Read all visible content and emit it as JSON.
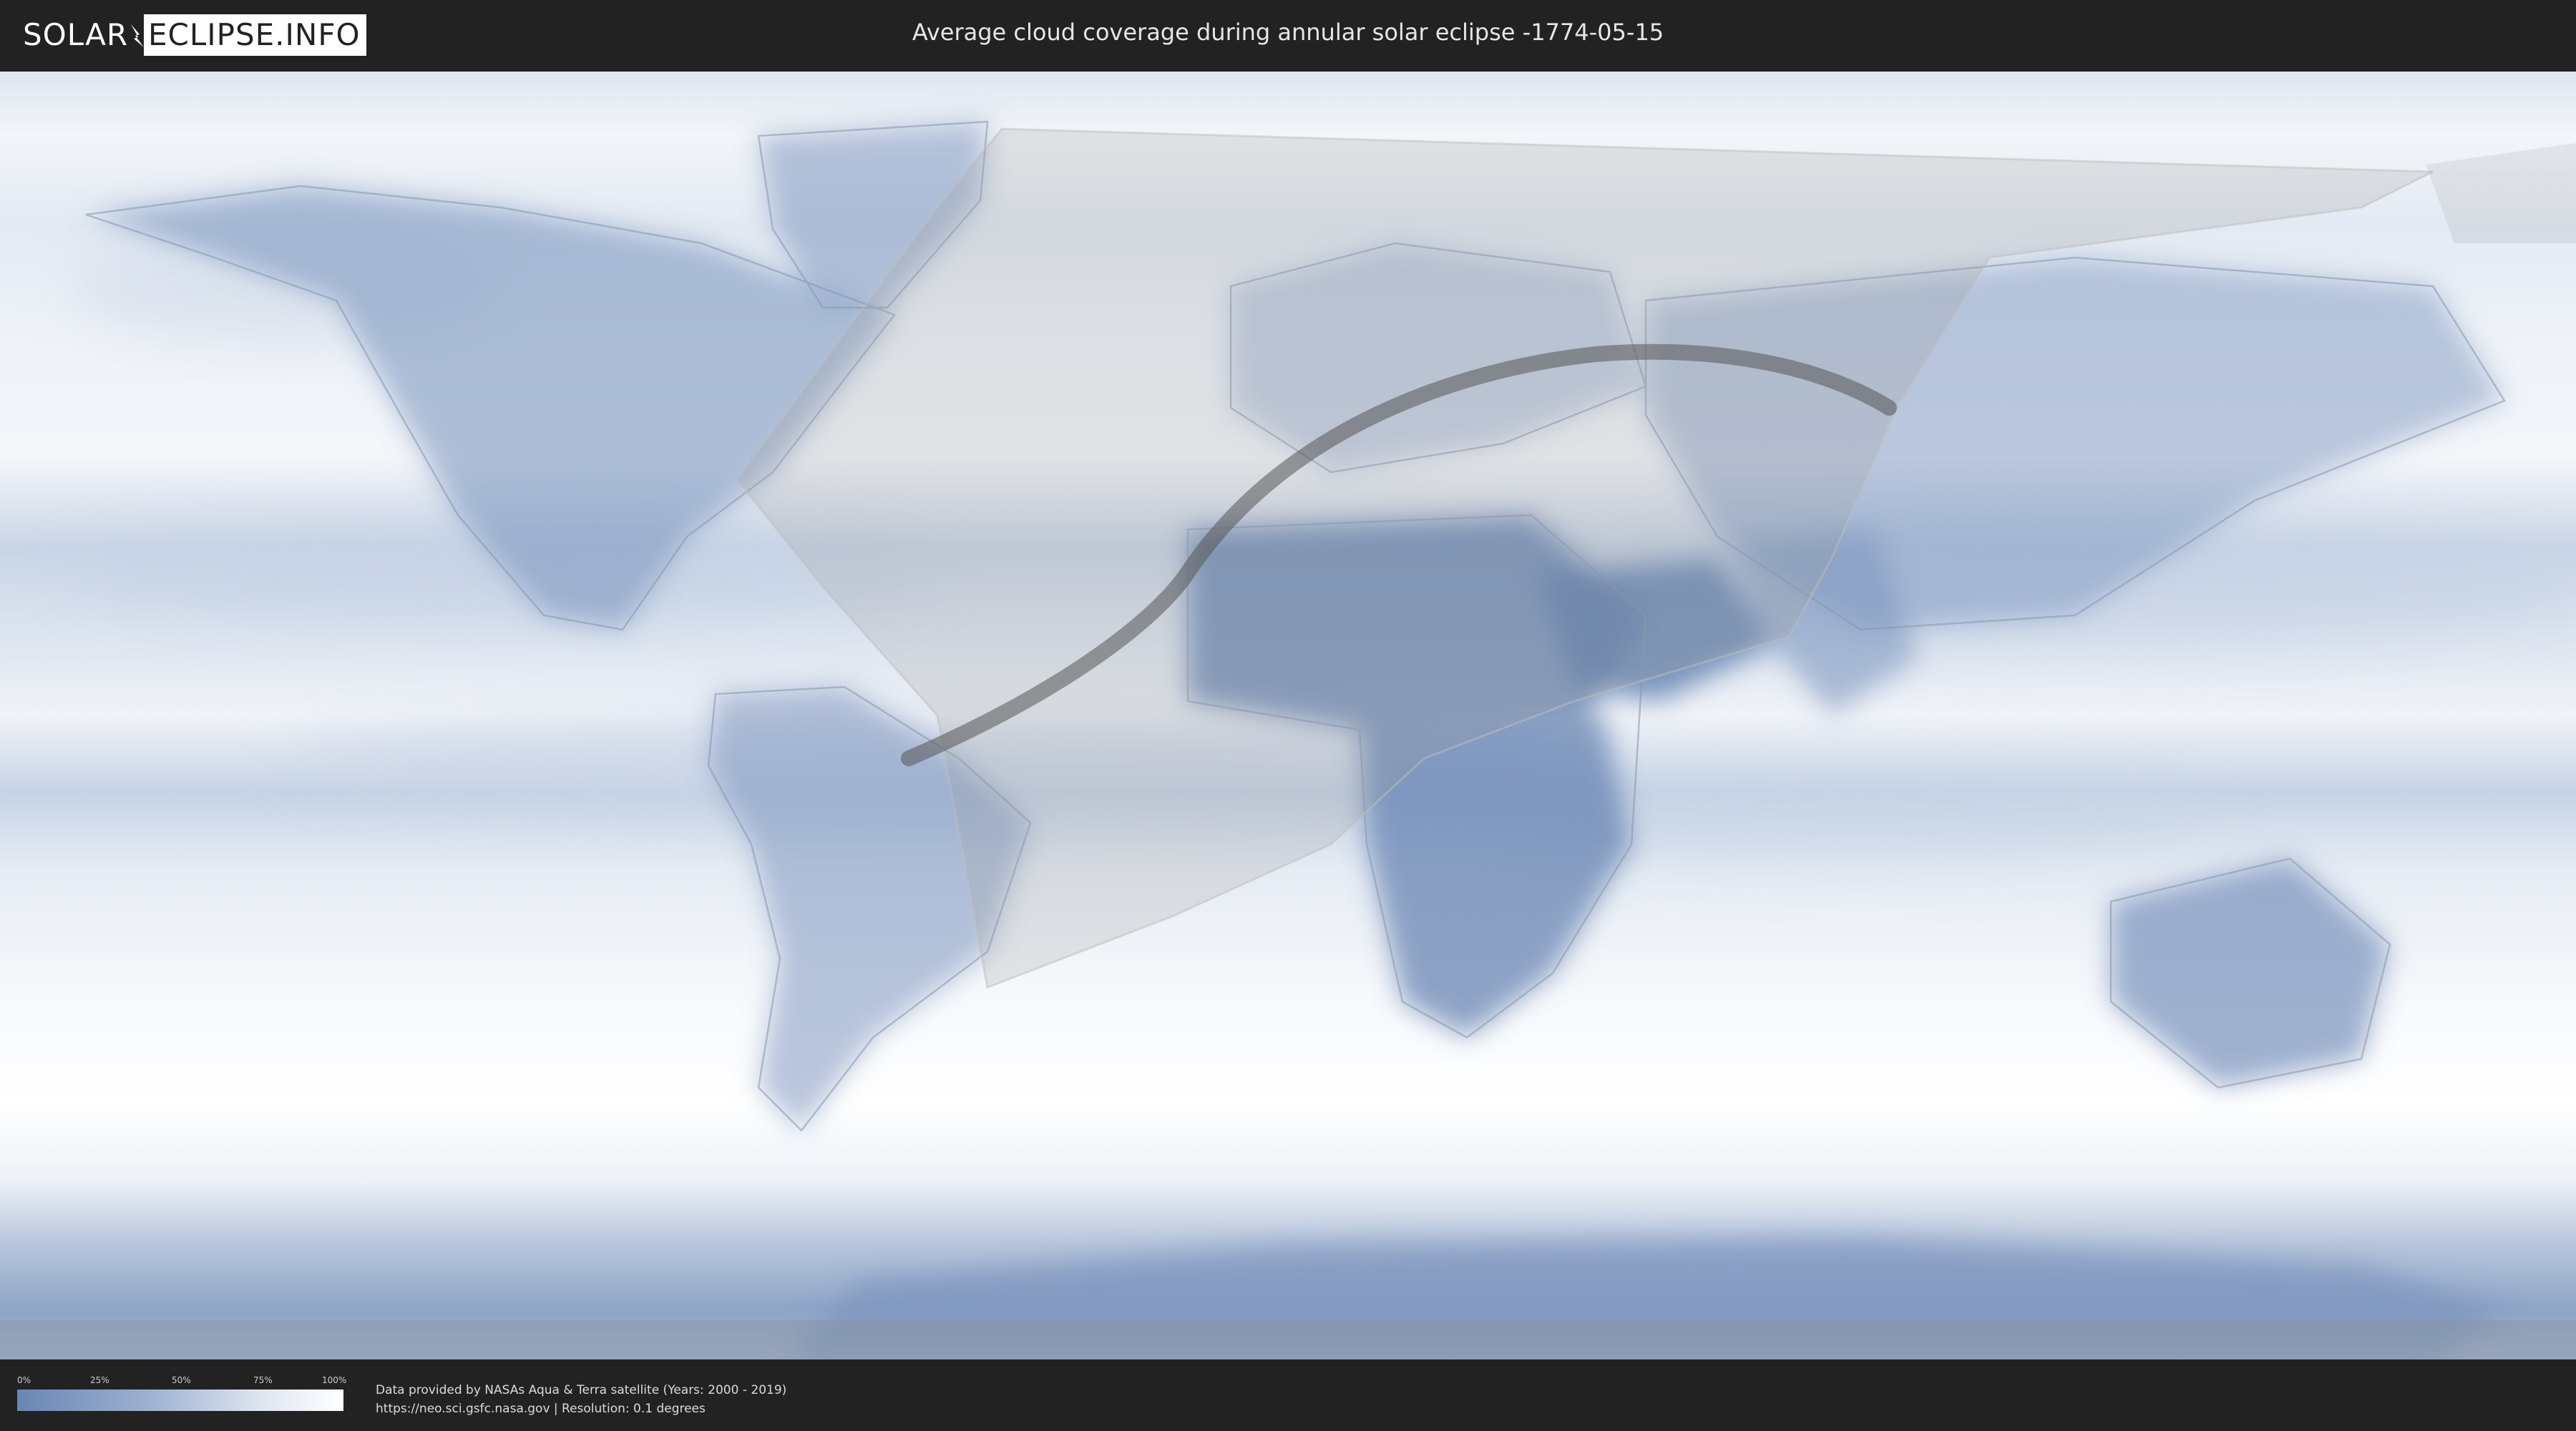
{
  "header": {
    "logo_left": "SOLAR",
    "logo_right": "ECLIPSE.INFO",
    "logo_icon": "lightning-bolt-icon",
    "title": "Average cloud coverage during annular solar eclipse -1774-05-15"
  },
  "map": {
    "projection": "equirectangular",
    "overlays": [
      "eclipse-visibility-region",
      "annular-path"
    ],
    "colors": {
      "clear_sky": "#5f7eae",
      "full_cloud": "#ffffff",
      "visibility_overlay": "#9a9a9a",
      "annular_path": "#555555"
    }
  },
  "legend": {
    "ticks": [
      "0%",
      "25%",
      "50%",
      "75%",
      "100%"
    ],
    "tick_values": [
      0,
      25,
      50,
      75,
      100
    ],
    "colors": [
      "#6a86b5",
      "#ffffff"
    ]
  },
  "footer": {
    "line1": "Data provided by NASAs Aqua & Terra satellite (Years: 2000 - 2019)",
    "line2": "https://neo.sci.gsfc.nasa.gov | Resolution: 0.1 degrees"
  }
}
